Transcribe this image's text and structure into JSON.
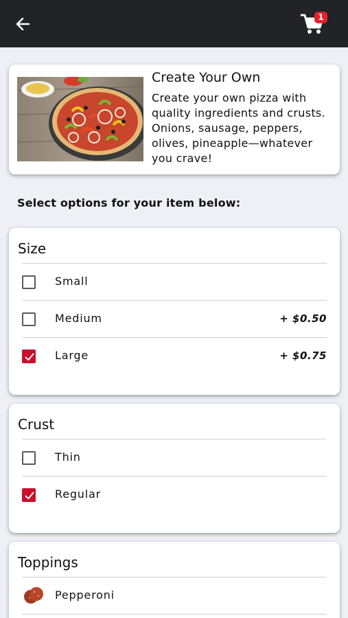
{
  "header": {
    "back_icon": "arrow-left-icon",
    "cart_icon": "shopping-cart-icon",
    "cart_count": "1",
    "background": "#222326",
    "badge_color": "#e3222c"
  },
  "item": {
    "title": "Create Your Own",
    "description": "Create your own pizza with quality ingredients and crusts. Onions, sausage, peppers, olives, pineapple—whatever you crave!"
  },
  "prompt": "Select options for your item below:",
  "sections": {
    "size": {
      "title": "Size",
      "options": [
        {
          "label": "Small",
          "price": "",
          "checked": false
        },
        {
          "label": "Medium",
          "price": "+ $0.50",
          "checked": false
        },
        {
          "label": "Large",
          "price": "+ $0.75",
          "checked": true
        }
      ]
    },
    "crust": {
      "title": "Crust",
      "options": [
        {
          "label": "Thin",
          "checked": false
        },
        {
          "label": "Regular",
          "checked": true
        }
      ]
    },
    "toppings": {
      "title": "Toppings",
      "options": [
        {
          "label": "Pepperoni",
          "icon": "pepperoni-icon"
        }
      ]
    }
  },
  "colors": {
    "accent": "#c8102e",
    "background": "#eef0f6"
  }
}
